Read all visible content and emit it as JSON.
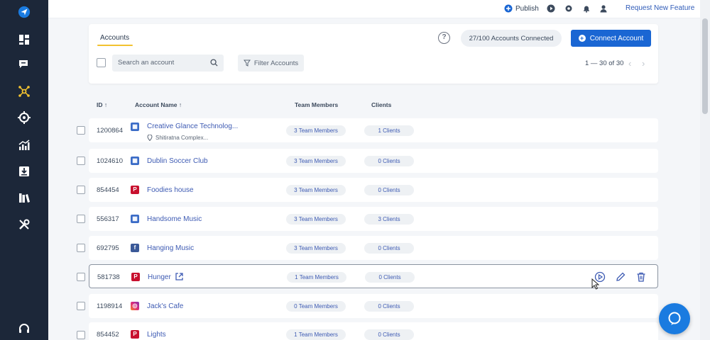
{
  "topbar": {
    "publish_label": "Publish",
    "request_feature_label": "Request New Feature"
  },
  "header": {
    "tab_label": "Accounts",
    "help_glyph": "?",
    "accounts_connected": "27/100 Accounts Connected",
    "connect_label": "Connect Account",
    "search_placeholder": "Search an account",
    "filter_label": "Filter Accounts",
    "pagination": "1 — 30 of 30"
  },
  "table": {
    "col_id": "ID ↑",
    "col_name": "Account Name ↑",
    "col_team": "Team Members",
    "col_clients": "Clients",
    "rows": [
      {
        "id": "1200864",
        "name": "Creative Glance Technolog...",
        "sub": "Shitiratna Complex...",
        "platform": "google-business",
        "team": "3 Team Members",
        "clients": "1 Clients"
      },
      {
        "id": "1024610",
        "name": "Dublin Soccer Club",
        "platform": "google-business",
        "team": "3 Team Members",
        "clients": "0 Clients"
      },
      {
        "id": "854454",
        "name": "Foodies house",
        "platform": "pinterest",
        "team": "3 Team Members",
        "clients": "0 Clients"
      },
      {
        "id": "556317",
        "name": "Handsome Music",
        "platform": "google-business",
        "team": "3 Team Members",
        "clients": "3 Clients"
      },
      {
        "id": "692795",
        "name": "Hanging Music",
        "platform": "facebook",
        "team": "3 Team Members",
        "clients": "0 Clients"
      },
      {
        "id": "581738",
        "name": "Hunger",
        "platform": "pinterest",
        "team": "1 Team Members",
        "clients": "0 Clients"
      },
      {
        "id": "1198914",
        "name": "Jack's Cafe",
        "platform": "instagram",
        "team": "0 Team Members",
        "clients": "0 Clients"
      },
      {
        "id": "854452",
        "name": "Lights",
        "platform": "pinterest",
        "team": "1 Team Members",
        "clients": "0 Clients"
      }
    ]
  },
  "colors": {
    "sidebar_bg": "#1c2739",
    "primary": "#1a66d3",
    "link": "#3e5bb3",
    "accent_yellow": "#f2c230"
  }
}
